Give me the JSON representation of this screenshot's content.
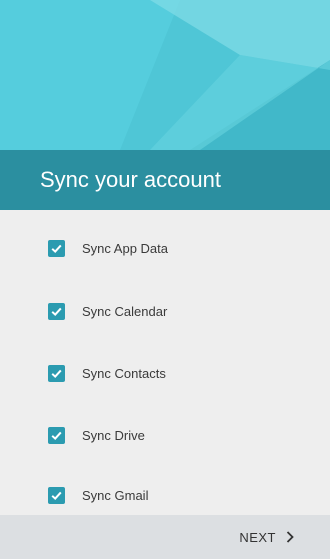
{
  "header": {
    "title": "Sync your account"
  },
  "sync_items": [
    {
      "label": "Sync App Data",
      "checked": true
    },
    {
      "label": "Sync Calendar",
      "checked": true
    },
    {
      "label": "Sync Contacts",
      "checked": true
    },
    {
      "label": "Sync Drive",
      "checked": true
    },
    {
      "label": "Sync Gmail",
      "checked": true
    }
  ],
  "footer": {
    "next_label": "NEXT",
    "next_icon": "chevron-right-icon"
  },
  "colors": {
    "hero": "#4fc8d8",
    "title_bar": "#2b8fa0",
    "checkbox": "#2b9bb0",
    "background": "#eeeeee",
    "footer": "#dcdfe2"
  }
}
